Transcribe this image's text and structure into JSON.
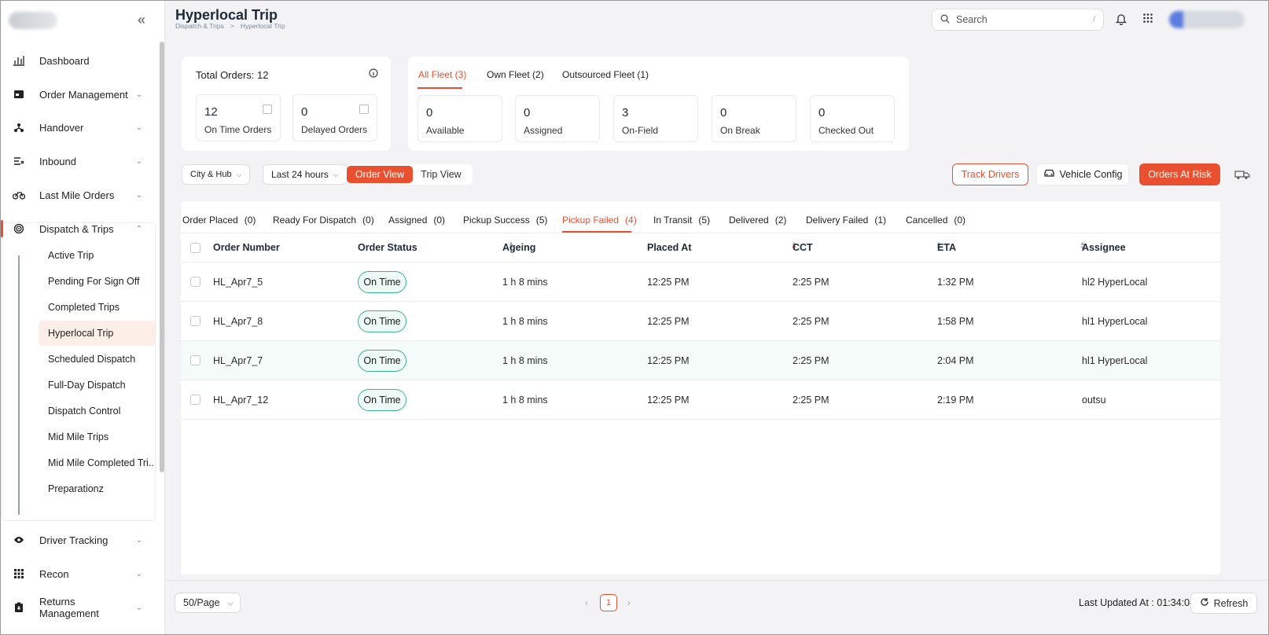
{
  "header": {
    "title": "Hyperlocal Trip",
    "breadcrumb": [
      "Dispatch & Trips",
      ">",
      "Hyperlocal Trip"
    ],
    "search_placeholder": "Search",
    "search_shortcut": "/"
  },
  "sidebar": {
    "collapse_glyph": "«",
    "items": [
      {
        "label": "Dashboard",
        "icon": "bar-chart-icon"
      },
      {
        "label": "Order Management",
        "icon": "order-icon"
      },
      {
        "label": "Handover",
        "icon": "handover-icon"
      },
      {
        "label": "Inbound",
        "icon": "inbound-icon"
      },
      {
        "label": "Last Mile Orders",
        "icon": "bike-icon"
      },
      {
        "label": "Dispatch & Trips",
        "icon": "dispatch-icon",
        "expanded": true
      },
      {
        "label": "Driver Tracking",
        "icon": "eye-icon"
      },
      {
        "label": "Recon",
        "icon": "recon-icon"
      },
      {
        "label": "Returns Management",
        "icon": "returns-icon"
      }
    ],
    "subitems": [
      "Active Trip",
      "Pending For Sign Off",
      "Completed Trips",
      "Hyperlocal Trip",
      "Scheduled Dispatch",
      "Full-Day Dispatch",
      "Dispatch Control",
      "Mid Mile Trips",
      "Mid Mile Completed Tri...",
      "Preparationz"
    ],
    "active_subitem": "Hyperlocal Trip"
  },
  "orders_card": {
    "title": "Total Orders: 12",
    "stats": [
      {
        "value": "12",
        "label": "On Time Orders"
      },
      {
        "value": "0",
        "label": "Delayed Orders"
      }
    ]
  },
  "fleet_card": {
    "tabs": [
      "All Fleet (3)",
      "Own Fleet (2)",
      "Outsourced Fleet (1)"
    ],
    "active_tab": "All Fleet (3)",
    "stats": [
      {
        "value": "0",
        "label": "Available"
      },
      {
        "value": "0",
        "label": "Assigned"
      },
      {
        "value": "3",
        "label": "On-Field"
      },
      {
        "value": "0",
        "label": "On Break"
      },
      {
        "value": "0",
        "label": "Checked Out"
      }
    ]
  },
  "toolbar": {
    "city_hub": "City & Hub",
    "time_range": "Last 24 hours",
    "view_toggle": [
      "Order View",
      "Trip View"
    ],
    "active_view": "Order View",
    "track_drivers": "Track Drivers",
    "vehicle_config": "Vehicle Config",
    "orders_at_risk": "Orders At Risk"
  },
  "status_tabs": [
    {
      "label": "Order Placed",
      "count": "(0)"
    },
    {
      "label": "Ready For Dispatch",
      "count": "(0)"
    },
    {
      "label": "Assigned",
      "count": "(0)"
    },
    {
      "label": "Pickup Success",
      "count": "(5)"
    },
    {
      "label": "Pickup Failed",
      "count": "(4)",
      "active": true
    },
    {
      "label": "In Transit",
      "count": "(5)"
    },
    {
      "label": "Delivered",
      "count": "(2)"
    },
    {
      "label": "Delivery Failed",
      "count": "(1)"
    },
    {
      "label": "Cancelled",
      "count": "(0)"
    }
  ],
  "table": {
    "columns": [
      "Order Number",
      "Order Status",
      "Ageing",
      "Placed At",
      "CCT",
      "ETA",
      "Assignee"
    ],
    "rows": [
      {
        "order": "HL_Apr7_5",
        "status": "On Time",
        "ageing": "1 h 8 mins",
        "placed": "12:25 PM",
        "cct": "2:25 PM",
        "eta": "1:32 PM",
        "assignee": "hl2 HyperLocal"
      },
      {
        "order": "HL_Apr7_8",
        "status": "On Time",
        "ageing": "1 h 8 mins",
        "placed": "12:25 PM",
        "cct": "2:25 PM",
        "eta": "1:58 PM",
        "assignee": "hl1 HyperLocal"
      },
      {
        "order": "HL_Apr7_7",
        "status": "On Time",
        "ageing": "1 h 8 mins",
        "placed": "12:25 PM",
        "cct": "2:25 PM",
        "eta": "2:04 PM",
        "assignee": "hl1 HyperLocal"
      },
      {
        "order": "HL_Apr7_12",
        "status": "On Time",
        "ageing": "1 h 8 mins",
        "placed": "12:25 PM",
        "cct": "2:25 PM",
        "eta": "2:19 PM",
        "assignee": "outsu"
      }
    ]
  },
  "footer": {
    "per_page": "50/Page",
    "current_page": "1",
    "prev_glyph": "‹",
    "next_glyph": "›",
    "last_updated": "Last Updated At : 01:34:04",
    "refresh": "Refresh"
  },
  "colors": {
    "accent": "#e8502f",
    "on_time_border": "#3bb38d"
  }
}
